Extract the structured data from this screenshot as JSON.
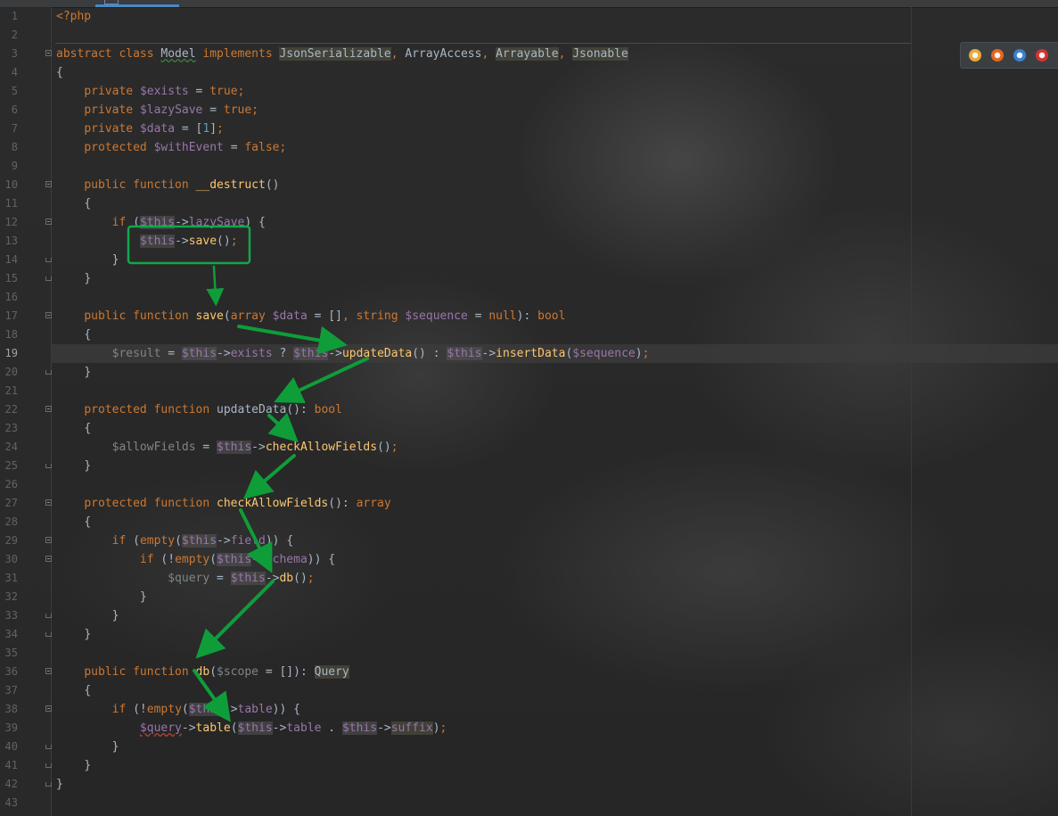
{
  "editor": {
    "language": "php",
    "current_line": "19",
    "lines": [
      {
        "n": "1",
        "html": "<span class=\"kw\">&lt;?php</span>"
      },
      {
        "n": "2",
        "html": ""
      },
      {
        "n": "3",
        "html": "<span class=\"kw\">abstract class </span><span class=\"txt uw\">Model</span><span class=\"kw\"> implements </span><span class=\"type\">JsonSerializable</span><span class=\"kw\">, </span><span class=\"txt\">ArrayAccess</span><span class=\"kw\">, </span><span class=\"type\">Arrayable</span><span class=\"kw\">, </span><span class=\"type\">Jsonable</span>"
      },
      {
        "n": "4",
        "html": "<span class=\"txt\">{</span>"
      },
      {
        "n": "5",
        "html": "    <span class=\"kw\">private </span><span class=\"var\">$exists</span><span class=\"txt\"> = </span><span class=\"kw\">true;</span>"
      },
      {
        "n": "6",
        "html": "    <span class=\"kw\">private </span><span class=\"var\">$lazySave</span><span class=\"txt\"> = </span><span class=\"kw\">true;</span>"
      },
      {
        "n": "7",
        "html": "    <span class=\"kw\">private </span><span class=\"var\">$data</span><span class=\"txt\"> = [</span><span class=\"num\">1</span><span class=\"txt\">]</span><span class=\"kw\">;</span>"
      },
      {
        "n": "8",
        "html": "    <span class=\"kw\">protected </span><span class=\"var\">$withEvent</span><span class=\"txt\"> = </span><span class=\"kw\">false;</span>"
      },
      {
        "n": "9",
        "html": ""
      },
      {
        "n": "10",
        "html": "    <span class=\"kw\">public function </span><span class=\"fn\">__destruct</span><span class=\"txt\">()</span>"
      },
      {
        "n": "11",
        "html": "    <span class=\"txt\">{</span>"
      },
      {
        "n": "12",
        "html": "        <span class=\"kw\">if </span><span class=\"txt\">(</span><span class=\"this\">$this</span><span class=\"txt\">-&gt;</span><span class=\"var\">lazySave</span><span class=\"txt\">) {</span>"
      },
      {
        "n": "13",
        "html": "            <span class=\"this\">$this</span><span class=\"txt\">-&gt;</span><span class=\"fn\">save</span><span class=\"txt\">()</span><span class=\"kw\">;</span>"
      },
      {
        "n": "14",
        "html": "        <span class=\"txt\">}</span>"
      },
      {
        "n": "15",
        "html": "    <span class=\"txt\">}</span>"
      },
      {
        "n": "16",
        "html": ""
      },
      {
        "n": "17",
        "html": "    <span class=\"kw\">public function </span><span class=\"fn\">save</span><span class=\"txt\">(</span><span class=\"kw\">array </span><span class=\"var\">$data</span><span class=\"txt\"> = []</span><span class=\"kw\">, string </span><span class=\"var\">$sequence</span><span class=\"txt\"> = </span><span class=\"kw\">null</span><span class=\"txt\">): </span><span class=\"kw\">bool</span>"
      },
      {
        "n": "18",
        "html": "    <span class=\"txt\">{</span>"
      },
      {
        "n": "19",
        "html": "        <span class=\"dim\">$result</span><span class=\"txt\"> = </span><span class=\"this\">$this</span><span class=\"txt\">-&gt;</span><span class=\"var\">exists</span><span class=\"txt\"> ? </span><span class=\"this\">$this</span><span class=\"txt\">-&gt;</span><span class=\"fn\">updateData</span><span class=\"txt\">() : </span><span class=\"this\">$this</span><span class=\"txt\">-&gt;</span><span class=\"fn\">insertData</span><span class=\"txt\">(</span><span class=\"var\">$sequence</span><span class=\"txt\">)</span><span class=\"kw\">;</span>"
      },
      {
        "n": "20",
        "html": "    <span class=\"txt\">}</span>"
      },
      {
        "n": "21",
        "html": ""
      },
      {
        "n": "22",
        "html": "    <span class=\"kw\">protected function </span><span class=\"fnd\">updateData</span><span class=\"txt\">(): </span><span class=\"kw\">bool</span>"
      },
      {
        "n": "23",
        "html": "    <span class=\"txt\">{</span>"
      },
      {
        "n": "24",
        "html": "        <span class=\"dim\">$allowFields</span><span class=\"txt\"> = </span><span class=\"this\">$this</span><span class=\"txt\">-&gt;</span><span class=\"fn\">checkAllowFields</span><span class=\"txt\">()</span><span class=\"kw\">;</span>"
      },
      {
        "n": "25",
        "html": "    <span class=\"txt\">}</span>"
      },
      {
        "n": "26",
        "html": ""
      },
      {
        "n": "27",
        "html": "    <span class=\"kw\">protected function </span><span class=\"fn\">checkAllowFields</span><span class=\"txt\">(): </span><span class=\"kw\">array</span>"
      },
      {
        "n": "28",
        "html": "    <span class=\"txt\">{</span>"
      },
      {
        "n": "29",
        "html": "        <span class=\"kw\">if </span><span class=\"txt\">(</span><span class=\"kw\">empty</span><span class=\"txt\">(</span><span class=\"this\">$this</span><span class=\"txt\">-&gt;</span><span class=\"var\">field</span><span class=\"txt\">)) {</span>"
      },
      {
        "n": "30",
        "html": "            <span class=\"kw\">if </span><span class=\"txt\">(!</span><span class=\"kw\">empty</span><span class=\"txt\">(</span><span class=\"this\">$this</span><span class=\"txt\">-&gt;</span><span class=\"var\">schema</span><span class=\"txt\">)) {</span>"
      },
      {
        "n": "31",
        "html": "                <span class=\"dim\">$query</span><span class=\"txt\"> = </span><span class=\"this\">$this</span><span class=\"txt\">-&gt;</span><span class=\"fn\">db</span><span class=\"txt\">()</span><span class=\"kw\">;</span>"
      },
      {
        "n": "32",
        "html": "            <span class=\"txt\">}</span>"
      },
      {
        "n": "33",
        "html": "        <span class=\"txt\">}</span>"
      },
      {
        "n": "34",
        "html": "    <span class=\"txt\">}</span>"
      },
      {
        "n": "35",
        "html": ""
      },
      {
        "n": "36",
        "html": "    <span class=\"kw\">public function </span><span class=\"fn\">db</span><span class=\"txt\">(</span><span class=\"dim\">$scope</span><span class=\"txt\"> = []): </span><span class=\"type\">Query</span>"
      },
      {
        "n": "37",
        "html": "    <span class=\"txt\">{</span>"
      },
      {
        "n": "38",
        "html": "        <span class=\"kw\">if </span><span class=\"txt\">(!</span><span class=\"kw\">empty</span><span class=\"txt\">(</span><span class=\"this\">$this</span><span class=\"txt\">-&gt;</span><span class=\"var\">table</span><span class=\"txt\">)) {</span>"
      },
      {
        "n": "39",
        "html": "            <span class=\"var ur\">$query</span><span class=\"txt\">-&gt;</span><span class=\"fn\">table</span><span class=\"txt\">(</span><span class=\"this\">$this</span><span class=\"txt\">-&gt;</span><span class=\"var\">table</span><span class=\"txt\"> . </span><span class=\"this\">$this</span><span class=\"txt\">-&gt;</span><span class=\"type\" style=\"color:#9876aa\">suffix</span><span class=\"txt\">)</span><span class=\"kw\">;</span>"
      },
      {
        "n": "40",
        "html": "        <span class=\"txt\">}</span>"
      },
      {
        "n": "41",
        "html": "    <span class=\"txt\">}</span>"
      },
      {
        "n": "42",
        "html": "<span class=\"txt\">}</span>"
      },
      {
        "n": "43",
        "html": ""
      }
    ],
    "fold_open_lines": [
      "3",
      "10",
      "12",
      "17",
      "22",
      "27",
      "29",
      "30",
      "36",
      "38"
    ],
    "fold_close_lines": [
      "14",
      "15",
      "20",
      "25",
      "33",
      "34",
      "40",
      "41",
      "42"
    ]
  },
  "browser_icons": [
    {
      "name": "chrome-icon",
      "color": "#e8a838"
    },
    {
      "name": "firefox-icon",
      "color": "#e3671f"
    },
    {
      "name": "safari-icon",
      "color": "#3a7fd0"
    },
    {
      "name": "opera-icon",
      "color": "#d23333"
    }
  ],
  "annotation": {
    "box_color": "#11a84a",
    "arrow_color": "#0f9d3a"
  }
}
